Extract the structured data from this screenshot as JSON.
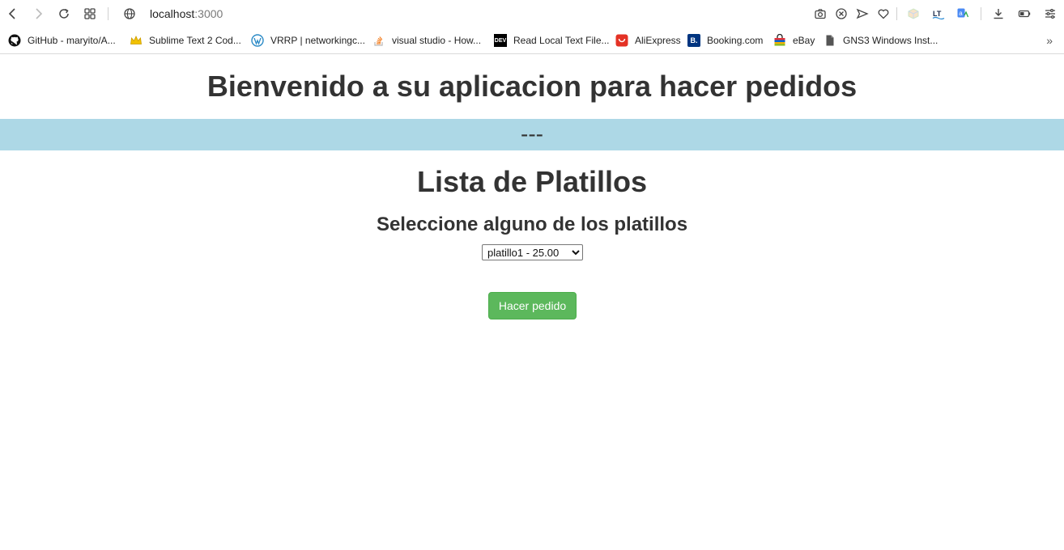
{
  "browser": {
    "url_host": "localhost",
    "url_port": ":3000",
    "bookmarks": [
      {
        "label": "GitHub - maryito/A...",
        "icon": "github-icon"
      },
      {
        "label": "Sublime Text 2 Cod...",
        "icon": "crown-icon"
      },
      {
        "label": "VRRP | networkingc...",
        "icon": "wordpress-icon"
      },
      {
        "label": "visual studio - How...",
        "icon": "stackoverflow-icon"
      },
      {
        "label": "Read Local Text File...",
        "icon": "dev-icon"
      },
      {
        "label": "AliExpress",
        "icon": "aliexpress-icon"
      },
      {
        "label": "Booking.com",
        "icon": "booking-icon"
      },
      {
        "label": "eBay",
        "icon": "ebay-icon"
      },
      {
        "label": "GNS3 Windows Inst...",
        "icon": "document-icon"
      }
    ],
    "dev_badge": "DEV",
    "booking_badge": "B.",
    "more_label": "»"
  },
  "page": {
    "title": "Bienvenido a su aplicacion para hacer pedidos",
    "band_text": "---",
    "list_title": "Lista de Platillos",
    "subtitle": "Seleccione alguno de los platillos",
    "selected_option": "platillo1 - 25.00",
    "order_button": "Hacer pedido"
  },
  "colors": {
    "band": "#add8e6",
    "button": "#5cb85c"
  }
}
